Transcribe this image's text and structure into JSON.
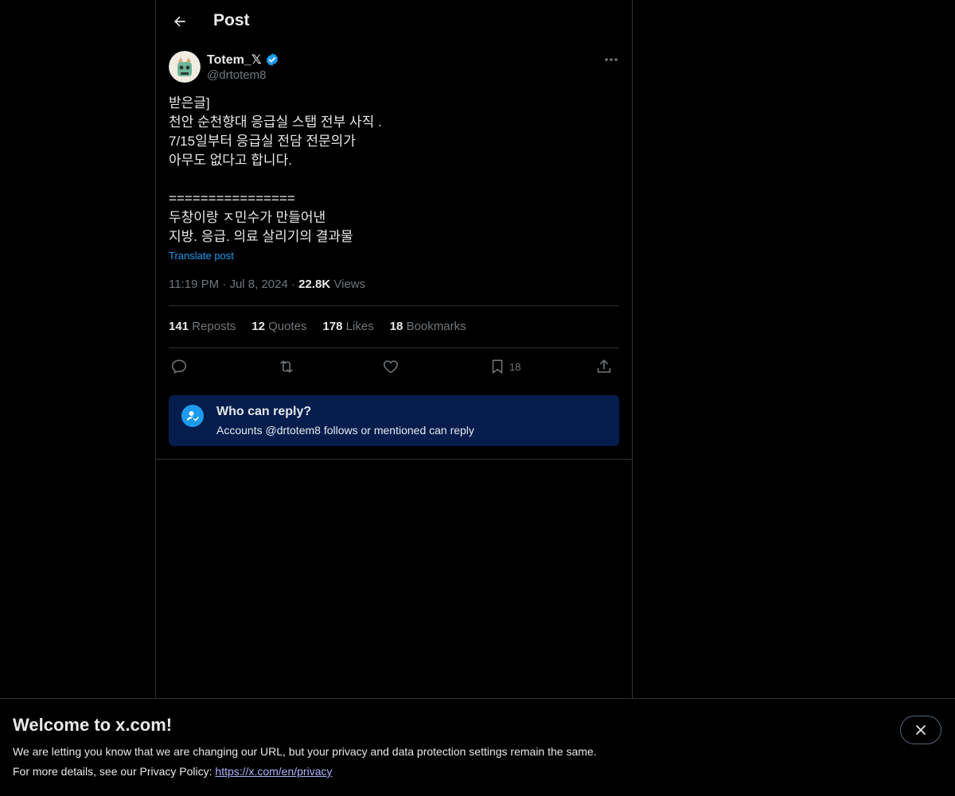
{
  "header": {
    "title": "Post"
  },
  "author": {
    "name": "Totem_𝕏",
    "handle": "@drtotem8",
    "verified": true
  },
  "post": {
    "lines": [
      "받은글]",
      "천안 순천향대 응급실 스탭 전부 사직 .",
      "7/15일부터 응급실 전담 전문의가",
      "아무도 없다고 합니다.",
      "",
      "================",
      "두창이랑 ㅈ민수가 만들어낸",
      "지방. 응급. 의료 살리기의 결과물"
    ],
    "translate_label": "Translate post",
    "time": "11:19 PM",
    "date": "Jul 8, 2024",
    "views_count": "22.8K",
    "views_label": "Views"
  },
  "stats": {
    "reposts_count": "141",
    "reposts_label": "Reposts",
    "quotes_count": "12",
    "quotes_label": "Quotes",
    "likes_count": "178",
    "likes_label": "Likes",
    "bookmarks_count": "18",
    "bookmarks_label": "Bookmarks"
  },
  "actions": {
    "bookmark_count": "18"
  },
  "reply_notice": {
    "title": "Who can reply?",
    "subtitle": "Accounts @drtotem8 follows or mentioned can reply"
  },
  "banner": {
    "title": "Welcome to x.com!",
    "text1": "We are letting you know that we are changing our URL, but your privacy and data protection settings remain the same.",
    "text2_prefix": "For more details, see our Privacy Policy: ",
    "link": "https://x.com/en/privacy"
  },
  "colors": {
    "accent": "#1d9bf0",
    "background": "#000000",
    "reply_box": "#051d4d"
  }
}
